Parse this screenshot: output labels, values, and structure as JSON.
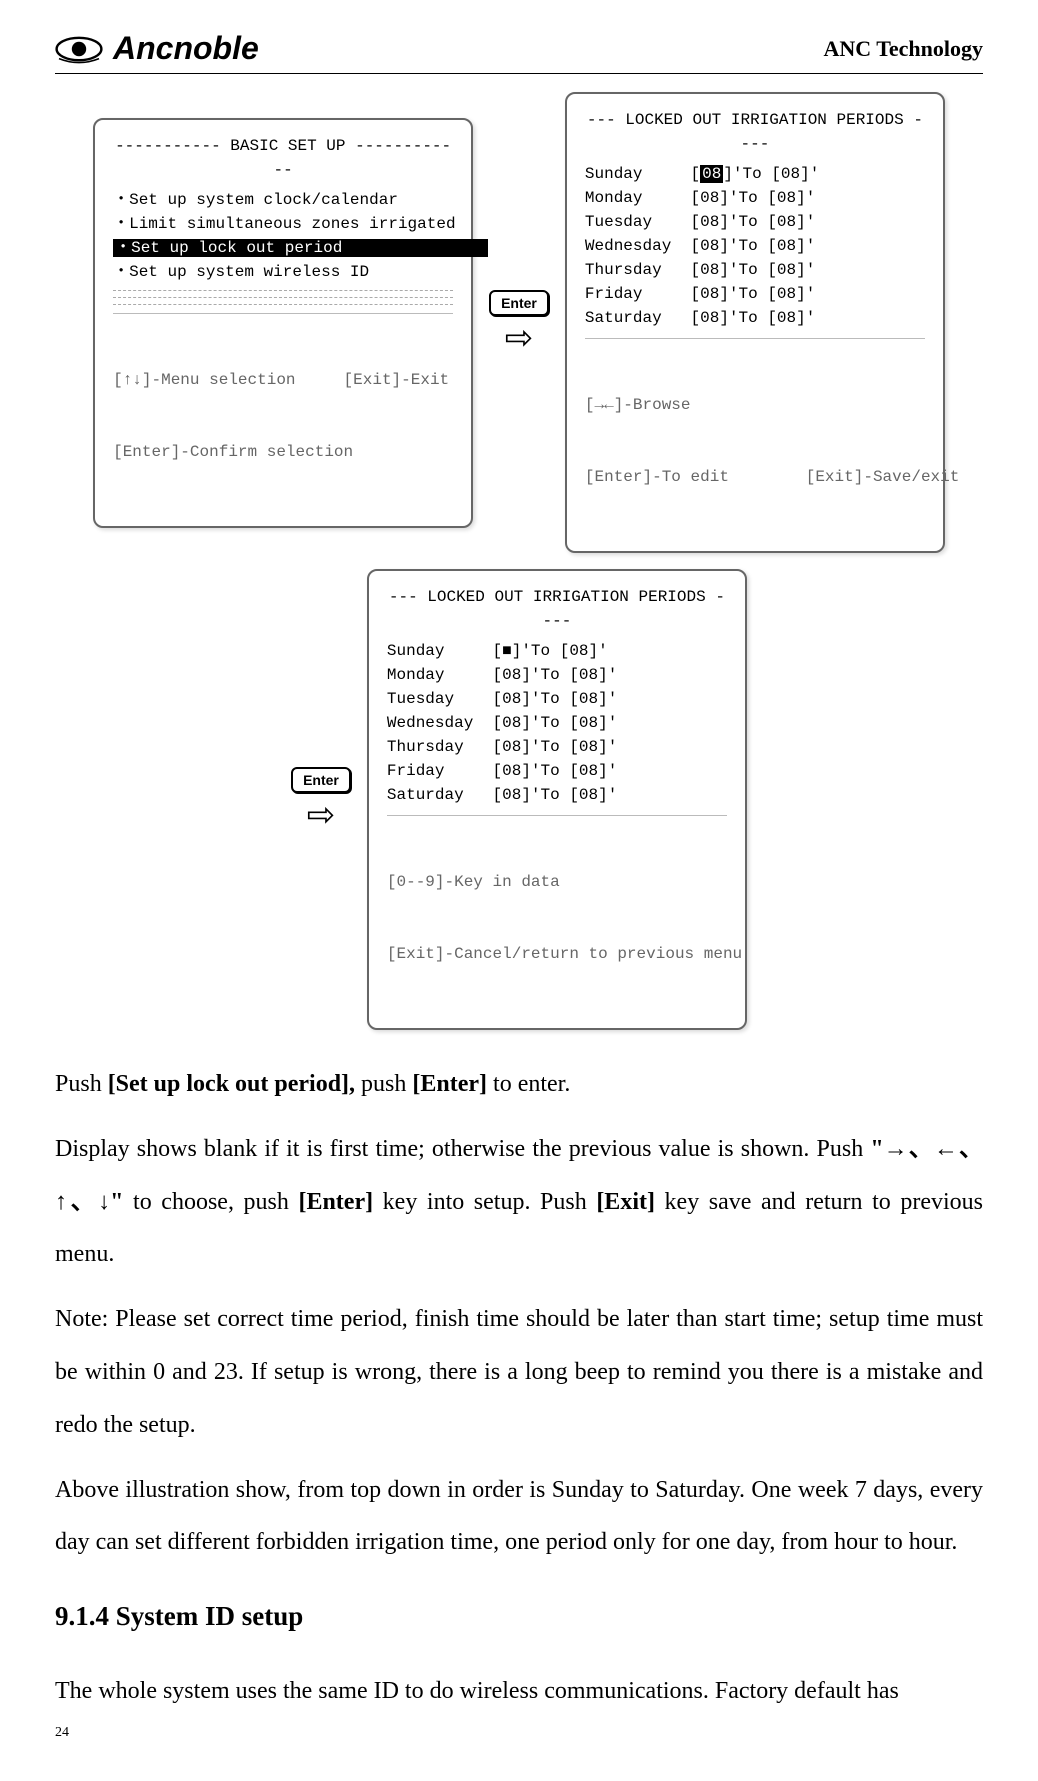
{
  "header": {
    "logo_text": "Ancnoble",
    "company": "ANC Technology"
  },
  "enter_label": "Enter",
  "arrow_glyph": "⇨",
  "screen1": {
    "title": "----------- BASIC SET UP ------------",
    "items": [
      "・Set up system clock/calendar",
      "・Limit simultaneous zones irrigated",
      "・Set up lock out period",
      "・Set up system wireless ID"
    ],
    "selected_index": 2,
    "hints_line1": "[↑↓]-Menu selection     [Exit]-Exit",
    "hints_line2": "[Enter]-Confirm selection"
  },
  "screen2": {
    "title": "--- LOCKED OUT IRRIGATION PERIODS ----",
    "rows": [
      {
        "day": "Sunday   ",
        "from": "08",
        "from_hi": true,
        "to": "08"
      },
      {
        "day": "Monday   ",
        "from": "08",
        "from_hi": false,
        "to": "08"
      },
      {
        "day": "Tuesday  ",
        "from": "08",
        "from_hi": false,
        "to": "08"
      },
      {
        "day": "Wednesday",
        "from": "08",
        "from_hi": false,
        "to": "08"
      },
      {
        "day": "Thursday ",
        "from": "08",
        "from_hi": false,
        "to": "08"
      },
      {
        "day": "Friday   ",
        "from": "08",
        "from_hi": false,
        "to": "08"
      },
      {
        "day": "Saturday ",
        "from": "08",
        "from_hi": false,
        "to": "08"
      }
    ],
    "hints_line1": "[→←]-Browse",
    "hints_line2": "[Enter]-To edit        [Exit]-Save/exit"
  },
  "screen3": {
    "title": "--- LOCKED OUT IRRIGATION PERIODS ----",
    "rows": [
      {
        "day": "Sunday   ",
        "from": "■",
        "from_hi": false,
        "to": "08"
      },
      {
        "day": "Monday   ",
        "from": "08",
        "from_hi": false,
        "to": "08"
      },
      {
        "day": "Tuesday  ",
        "from": "08",
        "from_hi": false,
        "to": "08"
      },
      {
        "day": "Wednesday",
        "from": "08",
        "from_hi": false,
        "to": "08"
      },
      {
        "day": "Thursday ",
        "from": "08",
        "from_hi": false,
        "to": "08"
      },
      {
        "day": "Friday   ",
        "from": "08",
        "from_hi": false,
        "to": "08"
      },
      {
        "day": "Saturday ",
        "from": "08",
        "from_hi": false,
        "to": "08"
      }
    ],
    "hints_line1": "[0--9]-Key in data",
    "hints_line2": "[Exit]-Cancel/return to previous menu"
  },
  "body": {
    "p1_a": "Push ",
    "p1_b": "[Set up lock out period],",
    "p1_c": " push ",
    "p1_d": "[Enter]",
    "p1_e": " to enter.",
    "p2_a": "Display shows blank if it is first time; otherwise the previous value is shown. Push ",
    "p2_b": "\"→、←、↑、↓\"",
    "p2_c": " to choose, push ",
    "p2_d": "[Enter]",
    "p2_e": " key into setup. Push ",
    "p2_f": "[Exit]",
    "p2_g": " key save and return to previous menu.",
    "p3": "Note: Please set correct time period, finish time should be later than start time; setup time must be within 0 and 23. If setup is wrong, there is a long beep to remind you there is a mistake and redo the setup.",
    "p4": "Above illustration show, from top down in order is Sunday to Saturday. One week 7 days, every day can set different forbidden irrigation time, one period only for one day, from hour to hour.",
    "heading": "9.1.4 System ID setup",
    "p5": "The whole system uses the same ID to do wireless communications. Factory default has"
  },
  "page_number": "24"
}
